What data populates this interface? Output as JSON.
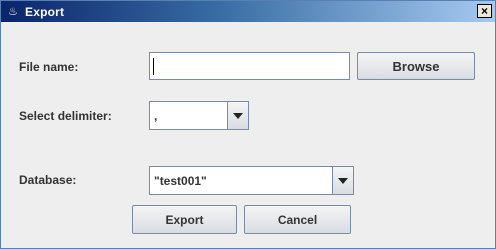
{
  "window": {
    "title": "Export",
    "title_icon": "app-icon",
    "close_glyph": "×"
  },
  "form": {
    "file_name_label": "File name:",
    "file_name_value": "",
    "browse_label": "Browse",
    "delimiter_label": "Select delimiter:",
    "delimiter_value": ",",
    "database_label": "Database:",
    "database_value": "\"test001\""
  },
  "actions": {
    "export_label": "Export",
    "cancel_label": "Cancel"
  }
}
